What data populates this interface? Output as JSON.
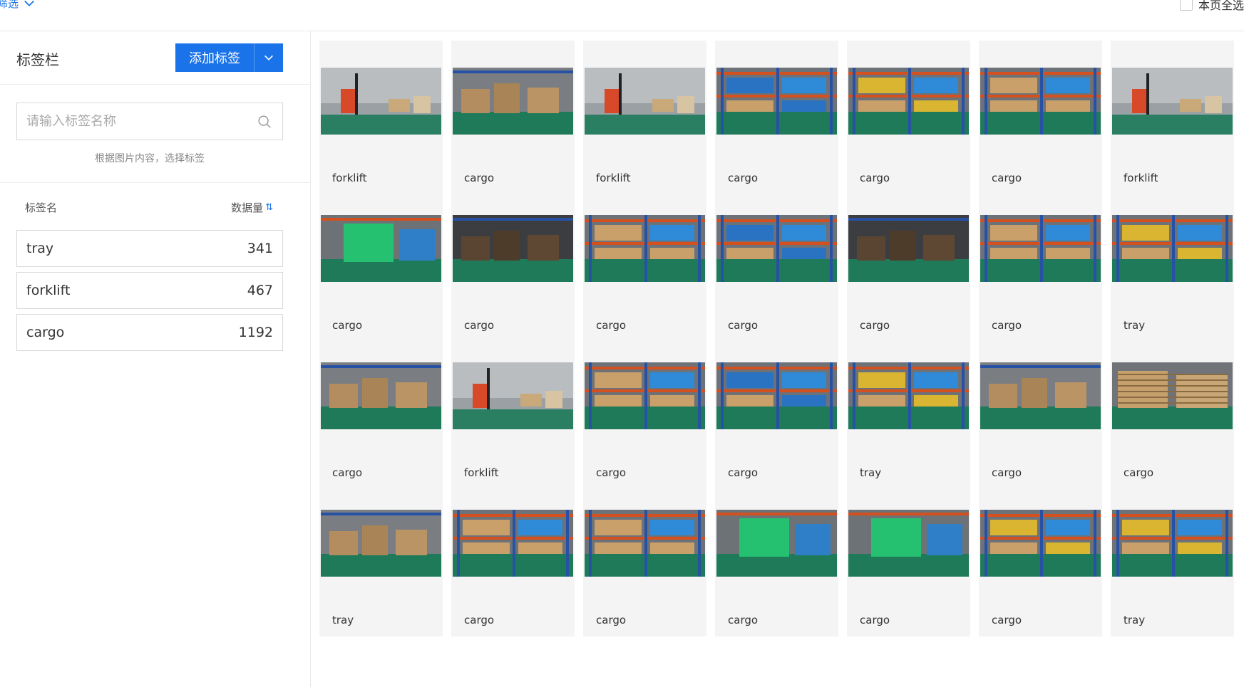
{
  "topbar": {
    "filter_label": "筛选",
    "page_select_label": "本页全选"
  },
  "sidebar": {
    "title": "标签栏",
    "add_button": "添加标签",
    "search_placeholder": "请输入标签名称",
    "hint": "根据图片内容，选择标签",
    "col_name": "标签名",
    "col_count": "数据量",
    "tags": [
      {
        "name": "tray",
        "count": "341"
      },
      {
        "name": "forklift",
        "count": "467"
      },
      {
        "name": "cargo",
        "count": "1192"
      }
    ]
  },
  "colors": {
    "accent": "#1a73e8"
  },
  "gallery": [
    {
      "label": "forklift",
      "scene": "forklift"
    },
    {
      "label": "cargo",
      "scene": "boxes"
    },
    {
      "label": "forklift",
      "scene": "forklift"
    },
    {
      "label": "cargo",
      "scene": "rack-blue"
    },
    {
      "label": "cargo",
      "scene": "rack-yellow"
    },
    {
      "label": "cargo",
      "scene": "rack-mixed"
    },
    {
      "label": "forklift",
      "scene": "forklift"
    },
    {
      "label": "cargo",
      "scene": "green-crates"
    },
    {
      "label": "cargo",
      "scene": "boxes-dark"
    },
    {
      "label": "cargo",
      "scene": "rack-mixed"
    },
    {
      "label": "cargo",
      "scene": "rack-blue"
    },
    {
      "label": "cargo",
      "scene": "boxes-dark"
    },
    {
      "label": "cargo",
      "scene": "rack-mixed"
    },
    {
      "label": "tray",
      "scene": "rack-yellow"
    },
    {
      "label": "cargo",
      "scene": "boxes"
    },
    {
      "label": "forklift",
      "scene": "forklift"
    },
    {
      "label": "cargo",
      "scene": "rack-mixed"
    },
    {
      "label": "cargo",
      "scene": "rack-blue"
    },
    {
      "label": "tray",
      "scene": "rack-yellow"
    },
    {
      "label": "cargo",
      "scene": "boxes"
    },
    {
      "label": "cargo",
      "scene": "pallets"
    },
    {
      "label": "tray",
      "scene": "boxes"
    },
    {
      "label": "cargo",
      "scene": "rack-mixed"
    },
    {
      "label": "cargo",
      "scene": "rack-mixed"
    },
    {
      "label": "cargo",
      "scene": "green-crates"
    },
    {
      "label": "cargo",
      "scene": "green-crates"
    },
    {
      "label": "cargo",
      "scene": "rack-yellow"
    },
    {
      "label": "tray",
      "scene": "rack-yellow"
    }
  ]
}
